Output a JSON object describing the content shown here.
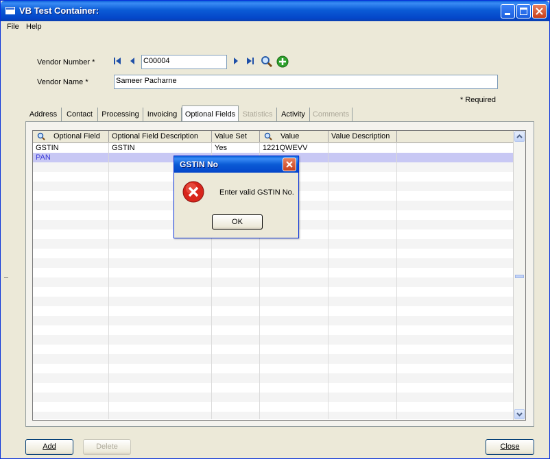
{
  "window": {
    "title": "VB Test Container:"
  },
  "menu": {
    "file": "File",
    "help": "Help"
  },
  "vendor": {
    "number_label": "Vendor Number *",
    "number_value": "C00004",
    "name_label": "Vendor Name *",
    "name_value": "Sameer Pacharne",
    "required_note": "* Required"
  },
  "tabs": [
    "Address",
    "Contact",
    "Processing",
    "Invoicing",
    "Optional Fields",
    "Statistics",
    "Activity",
    "Comments"
  ],
  "grid": {
    "headers": [
      "Optional Field",
      "Optional Field Description",
      "Value Set",
      "Value",
      "Value Description"
    ],
    "rows": [
      [
        "GSTIN",
        "GSTIN",
        "Yes",
        "1221QWEVV",
        ""
      ],
      [
        "PAN",
        "",
        "",
        "",
        ""
      ]
    ]
  },
  "buttons": {
    "add": "Add",
    "delete": "Delete",
    "close": "Close"
  },
  "dialog": {
    "title": "GSTIN No",
    "message": "Enter valid GSTIN No.",
    "ok": "OK"
  },
  "colors": {
    "titlebar": "#0b5bd6",
    "selected_row": "#c8c8f4",
    "error_icon": "#d8261c"
  }
}
